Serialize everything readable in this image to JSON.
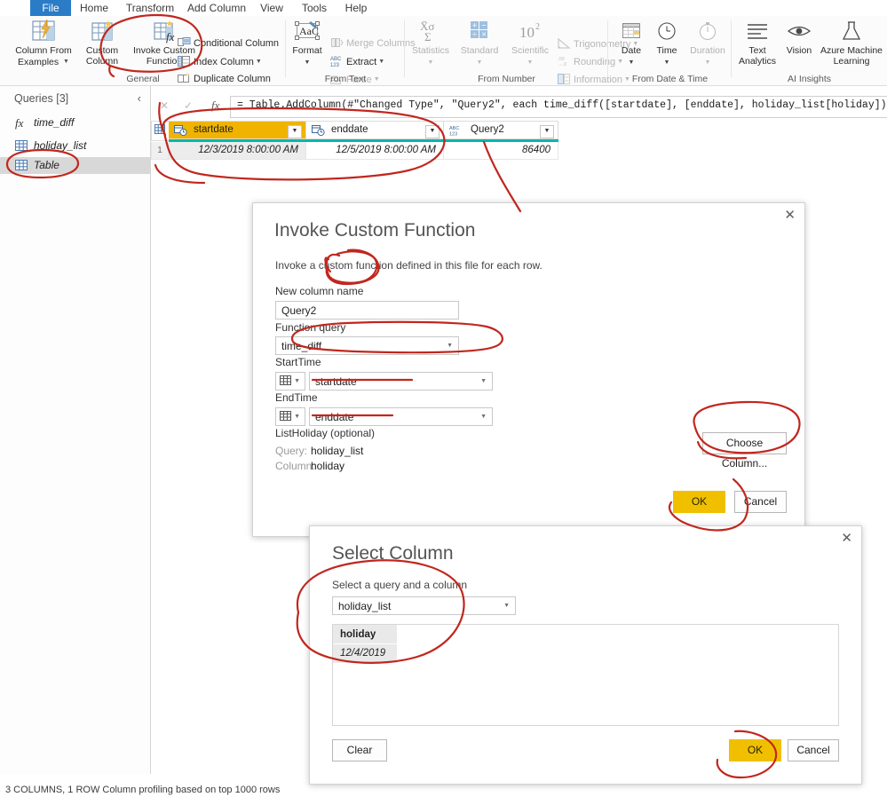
{
  "app": {
    "title": "Power Query Editor",
    "accent_blue": "#2a7cc7",
    "accent_yellow": "#F0C000",
    "accent_teal": "#01b8aa",
    "annotation_red": "#c0271e"
  },
  "ribbon": {
    "tabs": [
      {
        "label": "File",
        "active": true
      },
      {
        "label": "Home",
        "active": false
      },
      {
        "label": "Transform",
        "active": false
      },
      {
        "label": "Add Column",
        "active": false
      },
      {
        "label": "View",
        "active": false
      },
      {
        "label": "Tools",
        "active": false
      },
      {
        "label": "Help",
        "active": false
      }
    ],
    "groups": [
      {
        "name": "General",
        "big_buttons": [
          {
            "label": "Column From\nExamples",
            "icon": "table-lightning-icon",
            "has_caret": true,
            "disabled": false
          },
          {
            "label": "Custom\nColumn",
            "icon": "table-star-icon",
            "has_caret": false,
            "disabled": false
          },
          {
            "label": "Invoke Custom\nFunction",
            "icon": "table-fx-icon",
            "has_caret": false,
            "disabled": false
          }
        ],
        "small_buttons": [
          {
            "label": "Conditional Column",
            "icon": "conditional-column-icon",
            "has_caret": false,
            "disabled": false
          },
          {
            "label": "Index Column",
            "icon": "index-column-icon",
            "has_caret": true,
            "disabled": false
          },
          {
            "label": "Duplicate Column",
            "icon": "duplicate-column-icon",
            "has_caret": false,
            "disabled": false
          }
        ]
      },
      {
        "name": "From Text",
        "big_buttons": [
          {
            "label": "Format",
            "icon": "format-abc-icon",
            "has_caret": true,
            "disabled": false
          }
        ],
        "small_buttons": [
          {
            "label": "Merge Columns",
            "icon": "merge-columns-icon",
            "has_caret": false,
            "disabled": true
          },
          {
            "label": "Extract",
            "icon": "extract-abc123-icon",
            "has_caret": true,
            "disabled": false
          },
          {
            "label": "Parse",
            "icon": "parse-icon",
            "has_caret": true,
            "disabled": true
          }
        ]
      },
      {
        "name": "From Number",
        "big_buttons": [
          {
            "label": "Statistics",
            "icon": "statistics-sigma-icon",
            "has_caret": true,
            "disabled": true
          },
          {
            "label": "Standard",
            "icon": "standard-operators-icon",
            "has_caret": true,
            "disabled": true
          },
          {
            "label": "Scientific",
            "icon": "scientific-power-icon",
            "has_caret": true,
            "disabled": true
          }
        ],
        "small_buttons": [
          {
            "label": "Trigonometry",
            "icon": "trigonometry-icon",
            "has_caret": true,
            "disabled": true
          },
          {
            "label": "Rounding",
            "icon": "rounding-icon",
            "has_caret": true,
            "disabled": true
          },
          {
            "label": "Information",
            "icon": "information-icon",
            "has_caret": true,
            "disabled": true
          }
        ]
      },
      {
        "name": "From Date & Time",
        "big_buttons": [
          {
            "label": "Date",
            "icon": "calendar-icon",
            "has_caret": true,
            "disabled": false
          },
          {
            "label": "Time",
            "icon": "clock-icon",
            "has_caret": true,
            "disabled": false
          },
          {
            "label": "Duration",
            "icon": "stopwatch-icon",
            "has_caret": true,
            "disabled": true
          }
        ],
        "small_buttons": []
      },
      {
        "name": "AI Insights",
        "big_buttons": [
          {
            "label": "Text\nAnalytics",
            "icon": "text-analytics-lines-icon",
            "has_caret": false,
            "disabled": false
          },
          {
            "label": "Vision",
            "icon": "vision-eye-icon",
            "has_caret": false,
            "disabled": false
          },
          {
            "label": "Azure Machine\nLearning",
            "icon": "azure-ml-flask-icon",
            "has_caret": false,
            "disabled": false
          }
        ],
        "small_buttons": []
      }
    ]
  },
  "queries_pane": {
    "title": "Queries [3]",
    "collapse_icon": "chevron-left-icon",
    "items": [
      {
        "label": "time_diff",
        "icon": "function-fx-icon",
        "selected": false
      },
      {
        "label": "holiday_list",
        "icon": "table-icon",
        "selected": false
      },
      {
        "label": "Table",
        "icon": "table-icon",
        "selected": true
      }
    ]
  },
  "formula_bar": {
    "cancel_icon": "x-icon",
    "accept_icon": "check-icon",
    "fx_icon": "fx-icon",
    "formula": "= Table.AddColumn(#\"Changed Type\", \"Query2\", each time_diff([startdate], [enddate], holiday_list[holiday]))"
  },
  "grid": {
    "columns": [
      {
        "name": "startdate",
        "type_icon": "datetime-type-icon",
        "highlighted": true
      },
      {
        "name": "enddate",
        "type_icon": "datetime-type-icon",
        "highlighted": false
      },
      {
        "name": "Query2",
        "type_icon": "abc123-type-icon",
        "highlighted": false
      }
    ],
    "rows": [
      {
        "num": "1",
        "cells": [
          "12/3/2019 8:00:00 AM",
          "12/5/2019 8:00:00 AM",
          "86400"
        ]
      }
    ]
  },
  "status_bar": {
    "text": "3 COLUMNS, 1 ROW     Column profiling based on top 1000 rows"
  },
  "invoke_dialog": {
    "title": "Invoke Custom Function",
    "close_icon": "close-icon",
    "subtitle": "Invoke a custom function defined in this file for each row.",
    "new_column_name_label": "New column name",
    "new_column_name_value": "Query2",
    "function_query_label": "Function query",
    "function_query_value": "time_diff",
    "starttime_label": "StartTime",
    "starttime_value": "startdate",
    "starttime_type_icon": "column-type-icon",
    "endtime_label": "EndTime",
    "endtime_value": "enddate",
    "endtime_type_icon": "column-type-icon",
    "listholiday_label": "ListHoliday (optional)",
    "query_label": "Query:",
    "query_value": "holiday_list",
    "column_label": "Column:",
    "column_value": "holiday",
    "choose_column_label": "Choose Column...",
    "ok_label": "OK",
    "cancel_label": "Cancel"
  },
  "select_column_dialog": {
    "title": "Select Column",
    "close_icon": "close-icon",
    "subtitle": "Select a query and a column",
    "query_value": "holiday_list",
    "list_column_header": "holiday",
    "list_rows": [
      "12/4/2019"
    ],
    "clear_label": "Clear",
    "ok_label": "OK",
    "cancel_label": "Cancel"
  },
  "annotations": {
    "color": "#c0271e",
    "marks": [
      {
        "name": "circle-invoke-custom-function",
        "shape": "ellipse"
      },
      {
        "name": "circle-table-query-item",
        "shape": "ellipse"
      },
      {
        "name": "circle-grid-columns",
        "shape": "ellipse"
      },
      {
        "name": "line-to-query2-column",
        "shape": "line"
      },
      {
        "name": "circle-new-column-name",
        "shape": "ellipse"
      },
      {
        "name": "circle-function-query",
        "shape": "ellipse"
      },
      {
        "name": "underline-starttime",
        "shape": "line"
      },
      {
        "name": "underline-endtime",
        "shape": "line"
      },
      {
        "name": "circle-choose-column-button",
        "shape": "ellipse"
      },
      {
        "name": "circle-invoke-ok-cancel",
        "shape": "curve"
      },
      {
        "name": "circle-select-column-title",
        "shape": "ellipse"
      },
      {
        "name": "circle-select-column-ok",
        "shape": "curve"
      }
    ]
  }
}
